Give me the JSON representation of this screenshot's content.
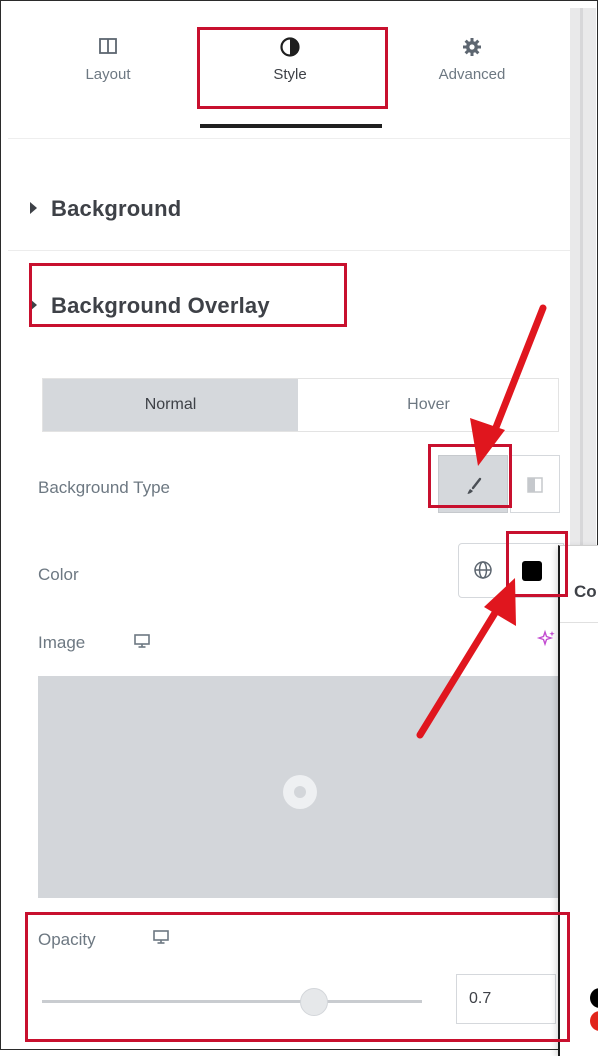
{
  "tabs": [
    {
      "label": "Layout",
      "icon": "columns-icon"
    },
    {
      "label": "Style",
      "icon": "half-circle-icon"
    },
    {
      "label": "Advanced",
      "icon": "gear-icon"
    }
  ],
  "active_tab": "Style",
  "sections": {
    "background": "Background",
    "background_overlay": "Background Overlay"
  },
  "state_toggle": {
    "normal": "Normal",
    "hover": "Hover",
    "active": "Normal"
  },
  "controls": {
    "background_type_label": "Background Type",
    "color_label": "Color",
    "image_label": "Image",
    "opacity_label": "Opacity",
    "opacity_value": "0.7",
    "opacity_slider_level": 0.7
  },
  "popover": {
    "title_partial": "Co"
  },
  "colors": {
    "annotation": "#c8102e",
    "toggle_active_bg": "#d5d8dc",
    "image_placeholder": "#d3d6da",
    "color_swatch": "#000000",
    "accent_ai": "#c34bd1"
  }
}
